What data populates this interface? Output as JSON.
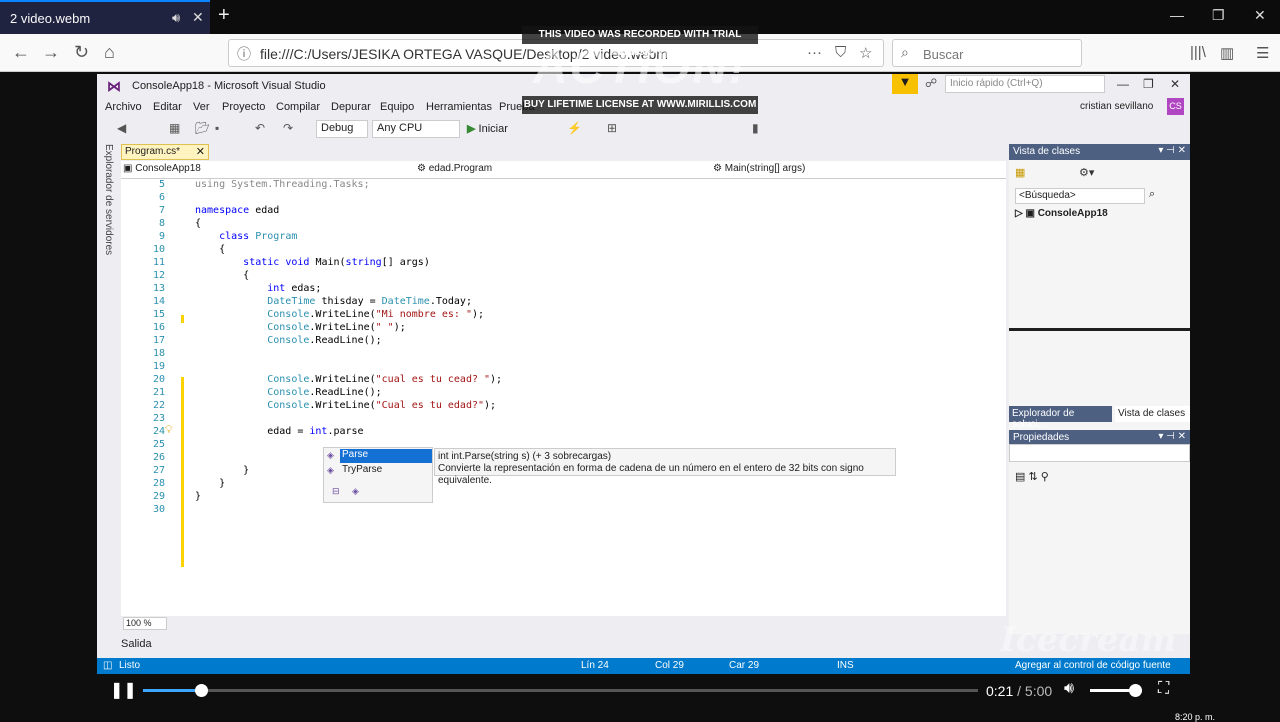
{
  "browser": {
    "tab_title": "2 video.webm",
    "url": "file:///C:/Users/JESIKA ORTEGA VASQUE/Desktop/2 video.webm",
    "search_placeholder": "Buscar"
  },
  "vs": {
    "title": "ConsoleApp18 - Microsoft Visual Studio",
    "quick_launch": "Inicio rápido (Ctrl+Q)",
    "menu": [
      "Archivo",
      "Editar",
      "Ver",
      "Proyecto",
      "Compilar",
      "Depurar",
      "Equipo",
      "Herramientas",
      "Prueba"
    ],
    "user": "cristian sevillano",
    "user_initials": "CS",
    "config": "Debug",
    "platform": "Any CPU",
    "start_label": "Iniciar",
    "left_strip": "Explorador de servidores",
    "doc_tab": "Program.cs*",
    "nav_project": "ConsoleApp18",
    "nav_class": "edad.Program",
    "nav_member": "Main(string[] args)",
    "zoom": "100 %",
    "output_label": "Salida",
    "status": {
      "ready": "Listo",
      "line": "Lín 24",
      "col": "Col 29",
      "char": "Car 29",
      "mode": "INS",
      "source_control": "Agregar al control de código fuente"
    }
  },
  "code": {
    "line_numbers": [
      "5",
      "6",
      "7",
      "8",
      "9",
      "10",
      "11",
      "12",
      "13",
      "14",
      "15",
      "16",
      "17",
      "18",
      "19",
      "20",
      "21",
      "22",
      "23",
      "24",
      "25",
      "26",
      "27",
      "28",
      "29",
      "30"
    ]
  },
  "intellisense": {
    "item1": "Parse",
    "item2": "TryParse",
    "tip_signature": "int int.Parse(string s) (+ 3 sobrecargas)",
    "tip_desc": "Convierte la representación en forma de cadena de un número en el entero de 32 bits con signo equivalente."
  },
  "panels": {
    "class_view": "Vista de clases",
    "search": "<Búsqueda>",
    "tree_item": "ConsoleApp18",
    "tab_solution": "Explorador de soluci...",
    "tab_classes": "Vista de clases",
    "properties": "Propiedades"
  },
  "watermark": {
    "top": "THIS VIDEO WAS RECORDED WITH TRIAL VERSION",
    "logo": "ACTION!",
    "bottom": "BUY LIFETIME LICENSE AT WWW.MIRILLIS.COM",
    "icecream": "Icecream"
  },
  "player": {
    "current": "0:21",
    "duration": "/ 5:00",
    "progress": 0.07,
    "volume": 0.87
  },
  "taskbar_clock": "8:20 p. m."
}
